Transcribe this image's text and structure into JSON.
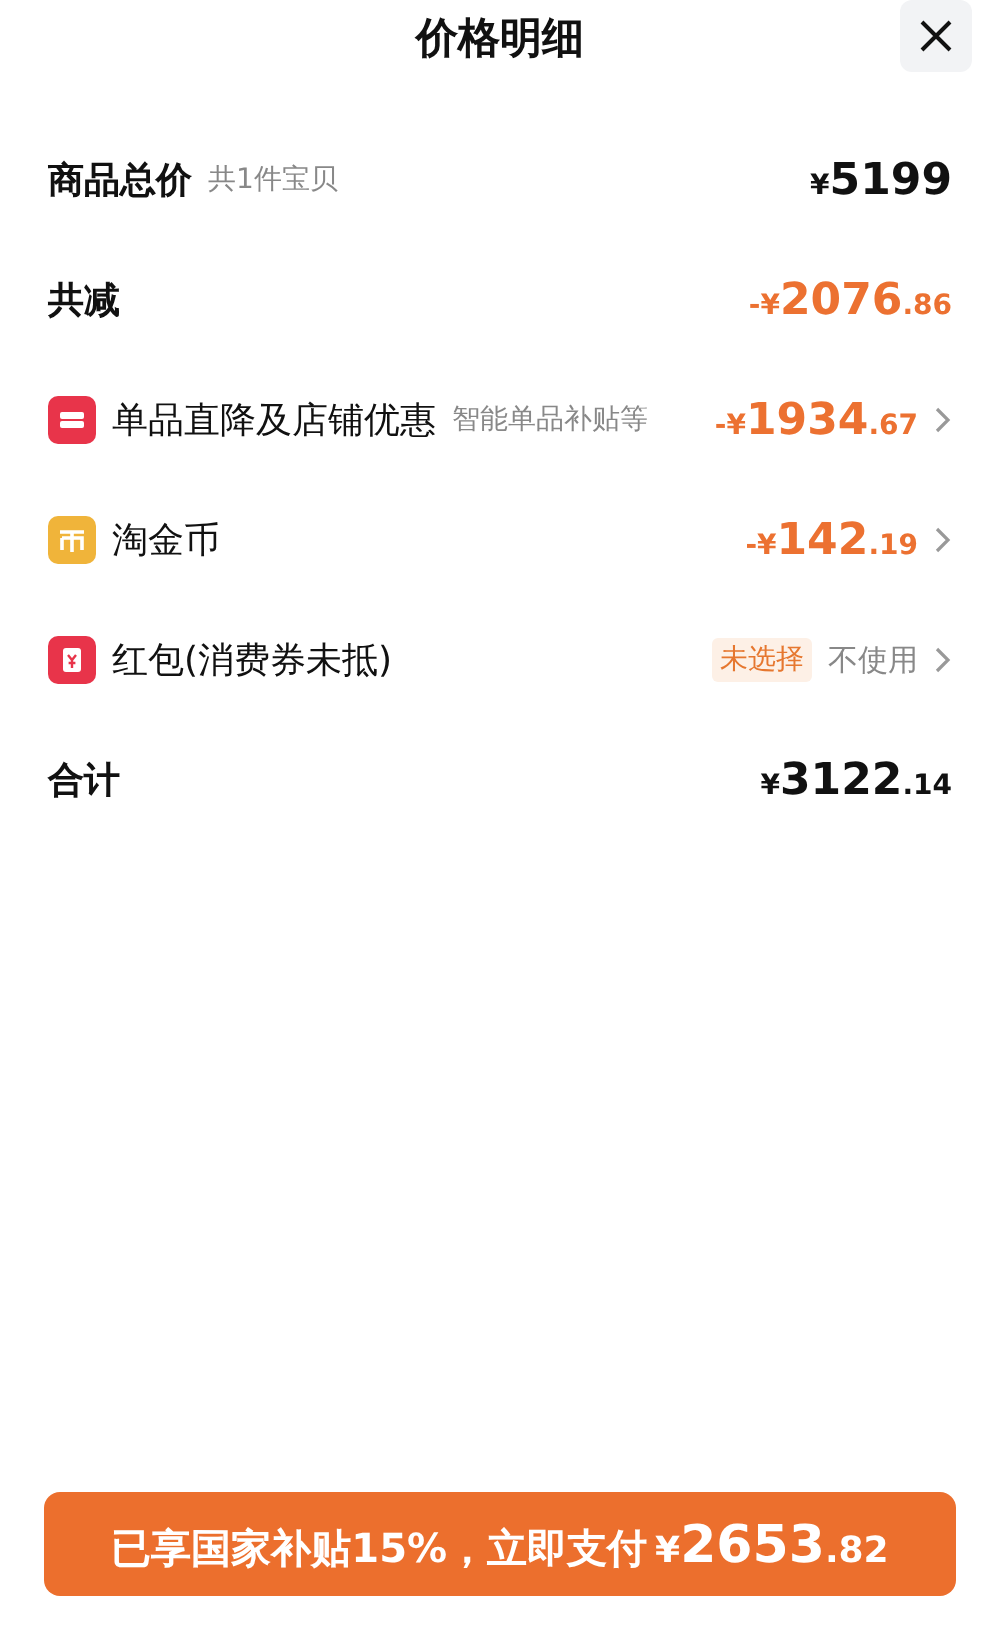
{
  "title": "价格明细",
  "rows": [
    {
      "kind": "summary",
      "label": "商品总价",
      "note": "共1件宝贝",
      "price": {
        "sign": "¥",
        "whole": "5199"
      },
      "chevron": false
    },
    {
      "kind": "discount_total",
      "label": "共减",
      "price": {
        "sign": "-¥",
        "whole": "2076",
        "fraction": ".86"
      },
      "chevron": false
    },
    {
      "kind": "shop_discount",
      "color": "#e8344a",
      "label": "单品直降及店铺优惠",
      "note": "智能单品补贴等",
      "price": {
        "sign": "-¥",
        "whole": "1934",
        "fraction": ".67"
      },
      "chevron": true
    },
    {
      "kind": "coin_discount",
      "color": "#f0b43a",
      "label": "淘金币",
      "price": {
        "sign": "-¥",
        "whole": "142",
        "fraction": ".19"
      },
      "chevron": true
    },
    {
      "kind": "voucher",
      "color": "#e8344a",
      "label": "红包(消费券未抵)",
      "tag": "未选择",
      "action": "不使用",
      "chevron": true
    },
    {
      "kind": "summary",
      "label": "合计",
      "price": {
        "sign": "¥",
        "whole": "3122",
        "fraction": ".14"
      },
      "chevron": false
    }
  ],
  "pay_button": {
    "label": "已享国家补贴15%，立即支付",
    "price": {
      "sign": "¥",
      "whole": "2653",
      "fraction": ".82"
    }
  }
}
